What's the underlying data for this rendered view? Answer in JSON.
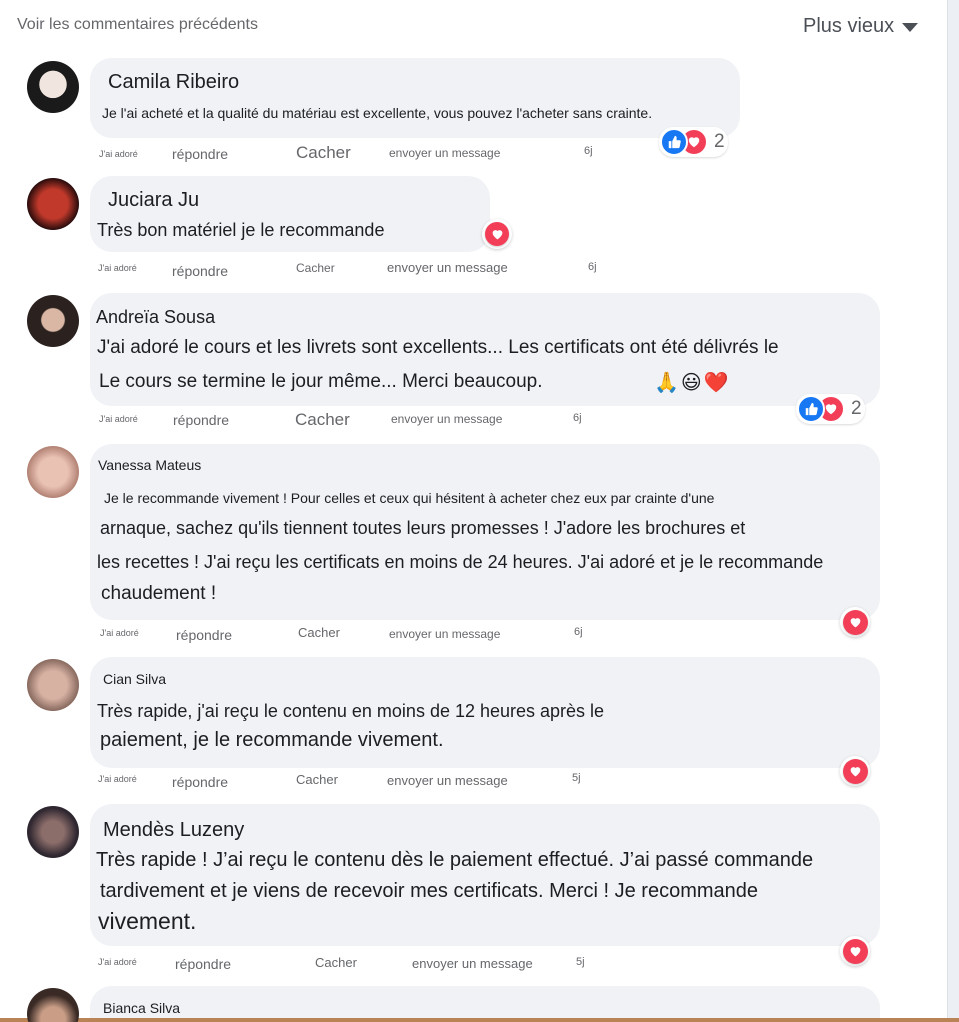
{
  "header": {
    "previous_comments": "Voir les commentaires précédents",
    "sort_label": "Plus vieux"
  },
  "actions": {
    "adore": "J'ai adoré",
    "reply": "répondre",
    "hide": "Cacher",
    "message": "envoyer un message"
  },
  "comments": [
    {
      "author": "Camila Ribeiro",
      "lines": [
        "Je l'ai acheté et la qualité du matériau est excellente, vous pouvez l'acheter sans crainte."
      ],
      "time": "6j",
      "reactions": [
        "like",
        "love"
      ],
      "reaction_count": "2"
    },
    {
      "author": "Juciara Ju",
      "lines": [
        "Très bon matériel je le recommande"
      ],
      "time": "6j",
      "reactions": [
        "love"
      ],
      "reaction_count": ""
    },
    {
      "author": "Andreïa Sousa",
      "lines": [
        "J'ai adoré le cours et les livrets sont excellents... Les certificats ont été délivrés le",
        "Le cours se termine le jour même... Merci beaucoup."
      ],
      "emojis": "🙏😃❤️",
      "time": "6j",
      "reactions": [
        "like",
        "love"
      ],
      "reaction_count": "2"
    },
    {
      "author": "Vanessa Mateus",
      "lines": [
        "Je le recommande vivement ! Pour celles et ceux qui hésitent à acheter chez eux par crainte d'une",
        "arnaque, sachez qu'ils tiennent toutes leurs promesses ! J'adore les brochures et",
        "les recettes ! J'ai reçu les certificats en moins de 24 heures. J'ai adoré et je le recommande",
        "chaudement !"
      ],
      "time": "6j",
      "reactions": [
        "love"
      ],
      "reaction_count": ""
    },
    {
      "author": "Cian Silva",
      "lines": [
        "Très rapide, j'ai reçu le contenu en moins de 12 heures après le",
        "paiement, je le recommande vivement."
      ],
      "time": "5j",
      "reactions": [
        "love"
      ],
      "reaction_count": ""
    },
    {
      "author": "Mendès Luzeny",
      "lines": [
        "Très rapide ! J’ai reçu le contenu dès le paiement effectué. J’ai passé commande",
        "tardivement et je viens de recevoir mes certificats. Merci ! Je recommande",
        "vivement."
      ],
      "time": "5j",
      "reactions": [
        "love"
      ],
      "reaction_count": ""
    },
    {
      "author": "Bianca Silva",
      "lines": [],
      "time": "",
      "reactions": [],
      "reaction_count": ""
    }
  ],
  "colors": {
    "bubble": "#f0f2f5",
    "like": "#1877f2",
    "love": "#f33e58",
    "secondary_text": "#65676b"
  }
}
